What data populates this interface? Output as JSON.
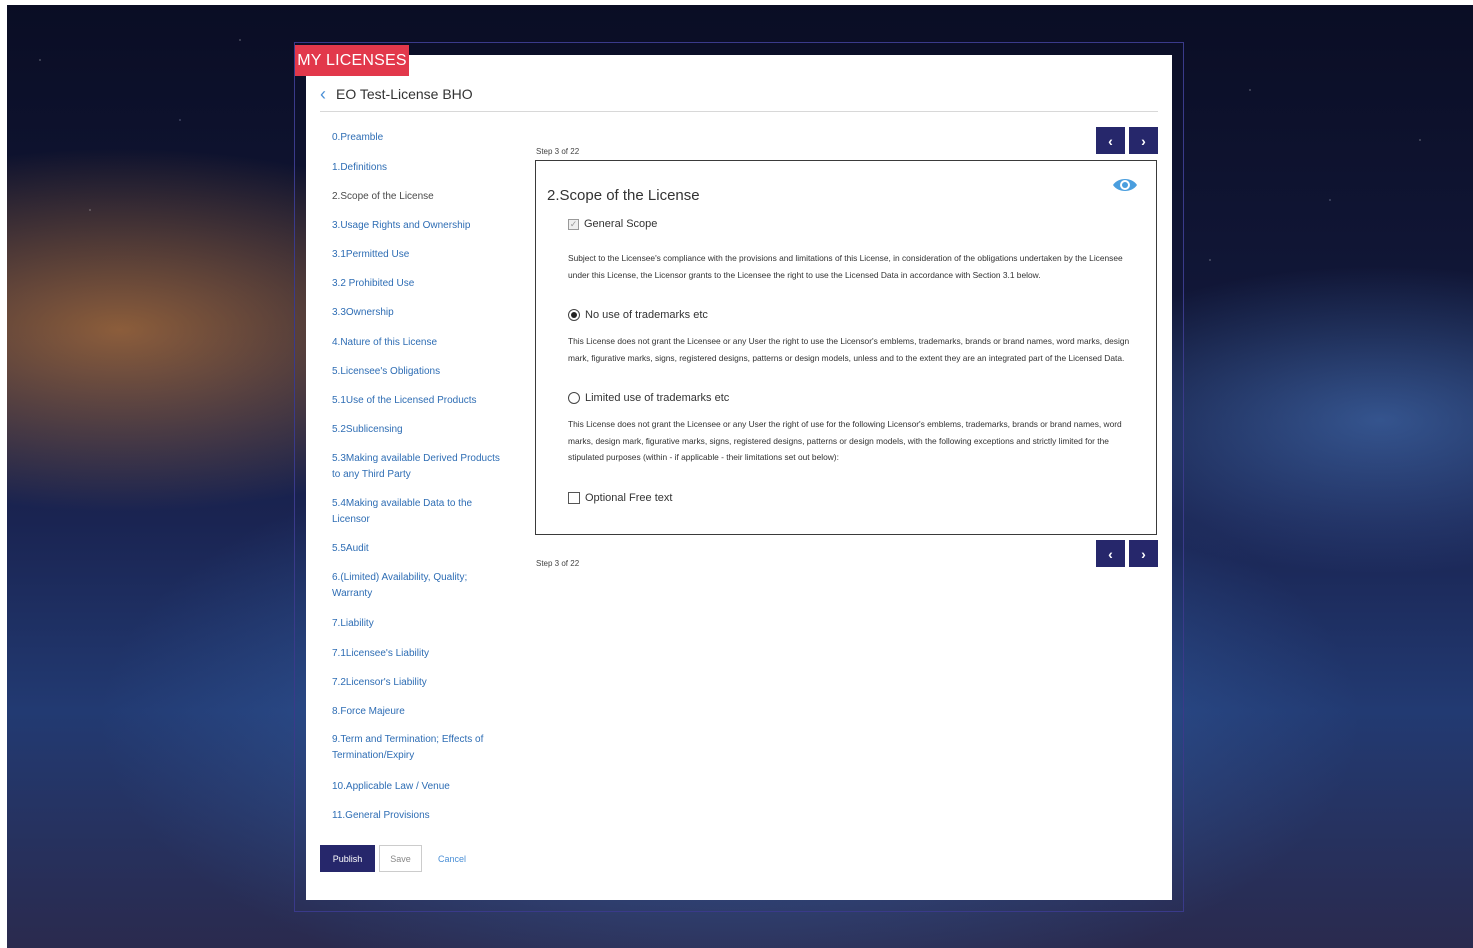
{
  "app": {
    "brand": "MY LICENSES",
    "license_title": "EO Test-License BHO"
  },
  "icons": {
    "back": "chevron-left-icon",
    "eye": "eye-icon",
    "prev": "chevron-left-icon",
    "next": "chevron-right-icon"
  },
  "nav": {
    "items": [
      "0.Preamble",
      "1.Definitions",
      "2.Scope of the License",
      "3.Usage Rights and Ownership",
      "3.1Permitted Use",
      "3.2 Prohibited Use",
      "3.3Ownership",
      "4.Nature of this License",
      "5.Licensee's Obligations",
      "5.1Use of the Licensed Products",
      "5.2Sublicensing",
      "5.3Making available Derived Products to any Third Party",
      "5.4Making available Data to the Licensor",
      "5.5Audit",
      "6.(Limited) Availability, Quality; Warranty",
      "7.Liability",
      "7.1Licensee's Liability",
      "7.2Licensor's Liability",
      "8.Force Majeure",
      "9.Term and Termination; Effects of Termination/Expiry",
      "10.Applicable Law / Venue",
      "11.General Provisions"
    ],
    "active_index": 2
  },
  "step": {
    "label": "Step 3 of 22",
    "prev_label": "‹",
    "next_label": "›"
  },
  "section": {
    "title": "2.Scope of the License",
    "general_scope_label": "General Scope",
    "general_scope_text": "Subject to the Licensee's compliance with the provisions and limitations of this License, in consideration of the obligations undertaken by the Licensee under this License, the Licensor grants to the Licensee the right to use the Licensed Data in accordance with Section 3.1 below.",
    "option1_label": "No use of trademarks etc",
    "option1_text": "This License does not grant the Licensee or any User the right to use the Licensor's emblems, trademarks, brands or brand names, word marks, design mark, figurative marks, signs, registered designs, patterns or design models, unless and to the extent they are an integrated part of the Licensed Data.",
    "option2_label": "Limited use of trademarks etc",
    "option2_text": "This License does not grant the Licensee or any User the right of use for the following Licensor's emblems, trademarks, brands or brand names, word marks, design mark, figurative marks, signs, registered designs, patterns or design models, with the following exceptions and strictly limited for the stipulated purposes (within - if applicable - their limitations set out below):",
    "optional_label": "Optional Free text"
  },
  "actions": {
    "publish": "Publish",
    "save": "Save",
    "cancel": "Cancel"
  },
  "colors": {
    "brand_red": "#e2384b",
    "navy": "#26276b",
    "link_blue": "#2e6db4"
  }
}
